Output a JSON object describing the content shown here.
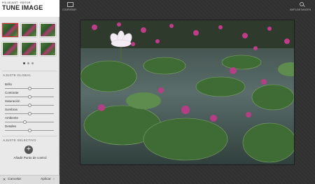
{
  "app": {
    "subtitle": "PIX ADJUST · EDITOR",
    "title": "TUNE IMAGE"
  },
  "panel": {
    "global_section": "AJUSTE GLOBAL",
    "sliders": [
      {
        "label": "Brillo",
        "value": 0.5
      },
      {
        "label": "Contraste",
        "value": 0.5
      },
      {
        "label": "Saturación",
        "value": 0.5
      },
      {
        "label": "Sombras",
        "value": 0.5
      },
      {
        "label": "Ambiente",
        "value": 0.4
      },
      {
        "label": "Detalles",
        "value": 0.5
      }
    ],
    "selective_section": "AJUSTE SELECTIVO",
    "add_control_point": "Añadir Punto de control"
  },
  "footer": {
    "cancel": "Cancelar",
    "apply": "Aplicar"
  },
  "toolbar": {
    "compare": "COMPARAR",
    "zoom": "AMPLIAR IMAGEN"
  },
  "colors": {
    "panel_bg": "#e9e9e9",
    "main_bg": "#303030",
    "accent_green": "#4f7a3a",
    "flower_pink": "#c23a8a"
  }
}
